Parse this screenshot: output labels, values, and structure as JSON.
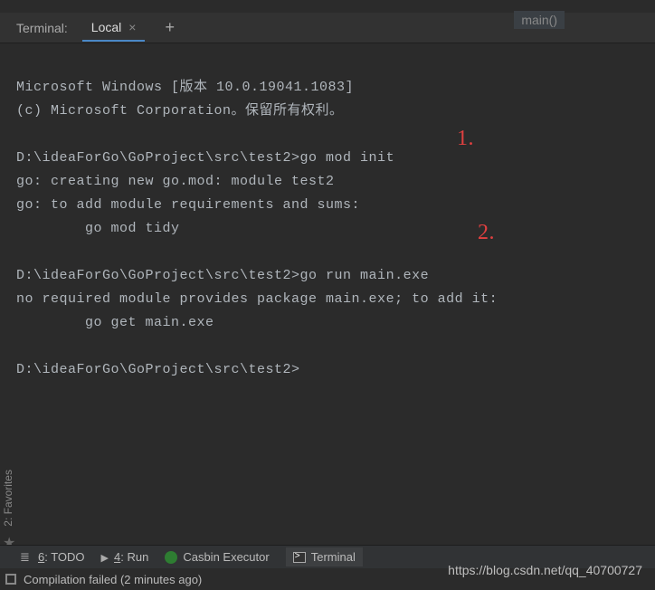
{
  "top_status": "main()",
  "panel": {
    "title": "Terminal:",
    "tab_label": "Local"
  },
  "terminal": {
    "lines": [
      "Microsoft Windows [版本 10.0.19041.1083]",
      "(c) Microsoft Corporation。保留所有权利。",
      "",
      "D:\\ideaForGo\\GoProject\\src\\test2>go mod init",
      "go: creating new go.mod: module test2",
      "go: to add module requirements and sums:",
      "        go mod tidy",
      "",
      "D:\\ideaForGo\\GoProject\\src\\test2>go run main.exe",
      "no required module provides package main.exe; to add it:",
      "        go get main.exe",
      "",
      "D:\\ideaForGo\\GoProject\\src\\test2>"
    ]
  },
  "annotations": {
    "a1": "1.",
    "a2": "2."
  },
  "side": {
    "favorites": "2: Favorites"
  },
  "bottom": {
    "todo_key": "6",
    "todo": ": TODO",
    "run_key": "4",
    "run": ": Run",
    "casbin": "Casbin Executor",
    "terminal": "Terminal"
  },
  "status": {
    "message": "Compilation failed (2 minutes ago)"
  },
  "watermark": "https://blog.csdn.net/qq_40700727"
}
